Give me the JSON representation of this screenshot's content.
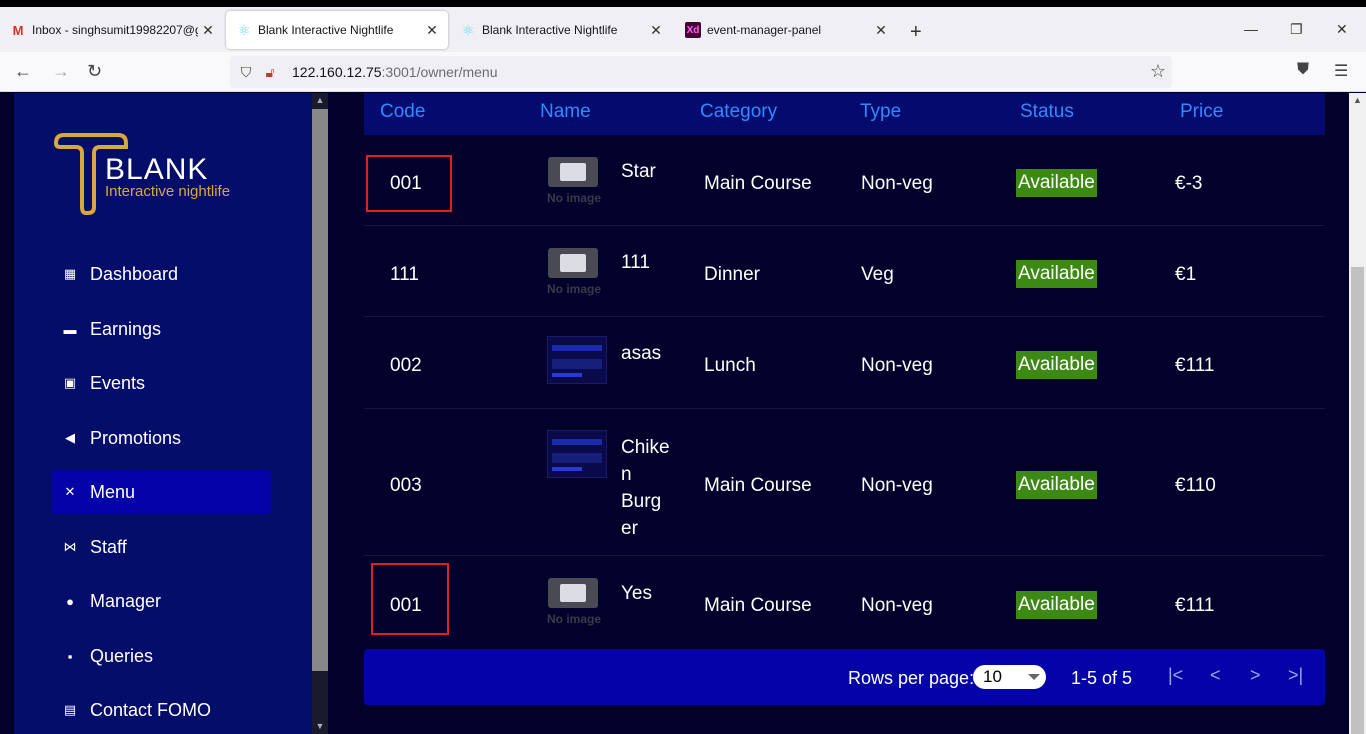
{
  "browser": {
    "tabs": [
      {
        "title": "Inbox - singhsumit19982207@g",
        "icon": "gmail-icon"
      },
      {
        "title": "Blank Interactive Nightlife",
        "icon": "react-icon",
        "active": true
      },
      {
        "title": "Blank Interactive Nightlife",
        "icon": "react-icon"
      },
      {
        "title": "event-manager-panel",
        "icon": "xd-icon"
      }
    ],
    "url_host": "122.160.12.75",
    "url_path": ":3001/owner/menu",
    "new_tab_label": "+",
    "xd_label": "Xd"
  },
  "brand": {
    "name": "BLANK",
    "tagline": "Interactive nightlife",
    "logo_color": "#d8a83a"
  },
  "sidebar": {
    "items": [
      {
        "label": "Dashboard",
        "icon": "dashboard-icon"
      },
      {
        "label": "Earnings",
        "icon": "earnings-icon"
      },
      {
        "label": "Events",
        "icon": "calendar-icon"
      },
      {
        "label": "Promotions",
        "icon": "megaphone-icon"
      },
      {
        "label": "Menu",
        "icon": "cutlery-icon",
        "active": true
      },
      {
        "label": "Staff",
        "icon": "staff-icon"
      },
      {
        "label": "Manager",
        "icon": "manager-icon"
      },
      {
        "label": "Queries",
        "icon": "chat-icon"
      },
      {
        "label": "Contact FOMO",
        "icon": "contact-icon"
      }
    ]
  },
  "table": {
    "columns": [
      "Code",
      "Name",
      "Category",
      "Type",
      "Status",
      "Price"
    ],
    "no_image_label": "No image",
    "rows": [
      {
        "code": "001",
        "name": "Star",
        "image": "none",
        "category": "Main Course",
        "type": "Non-veg",
        "status": "Available",
        "price": "€-3",
        "highlighted": true
      },
      {
        "code": "111",
        "name": "111",
        "image": "none",
        "category": "Dinner",
        "type": "Veg",
        "status": "Available",
        "price": "€1"
      },
      {
        "code": "002",
        "name": "asas",
        "image": "screenshot",
        "category": "Lunch",
        "type": "Non-veg",
        "status": "Available",
        "price": "€111"
      },
      {
        "code": "003",
        "name_lines": [
          "Chike",
          "n",
          "Burg",
          "er"
        ],
        "image": "screenshot",
        "category": "Main Course",
        "type": "Non-veg",
        "status": "Available",
        "price": "€110"
      },
      {
        "code": "001",
        "name": "Yes",
        "image": "none",
        "category": "Main Course",
        "type": "Non-veg",
        "status": "Available",
        "price": "€111",
        "highlighted": true
      }
    ]
  },
  "pagination": {
    "rows_per_page_label": "Rows per page:",
    "rows_per_page_value": "10",
    "range": "1-5 of 5"
  },
  "colors": {
    "sidebar_bg": "#050d6b",
    "active_nav": "#0303a8",
    "header_text": "#2f8bff",
    "status_badge": "#3c8a13",
    "highlight_border": "#e02020"
  }
}
